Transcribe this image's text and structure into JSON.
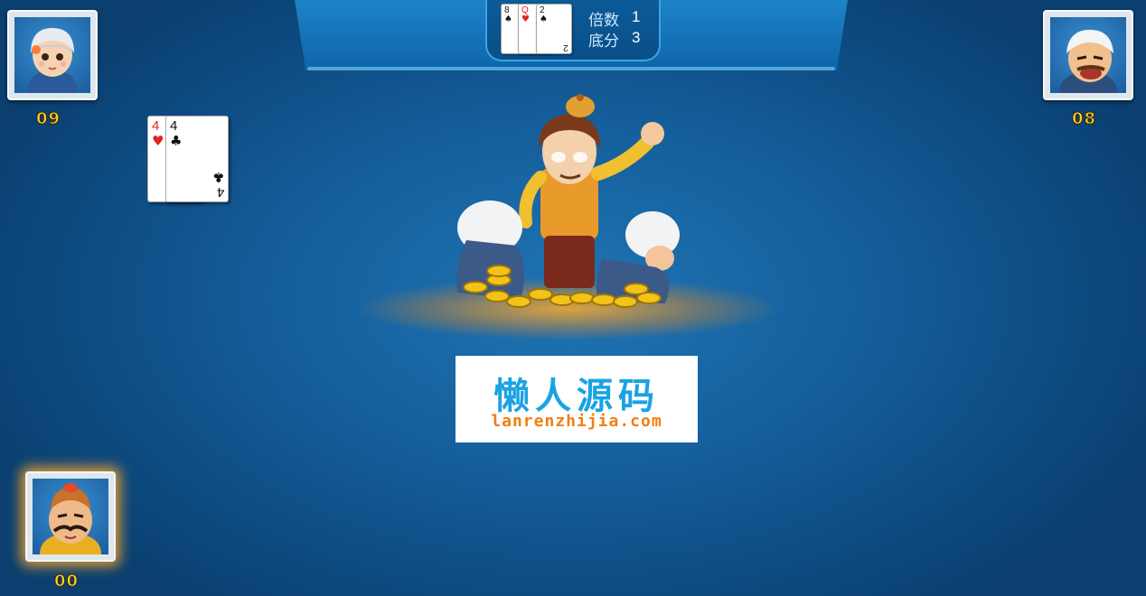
{
  "top_bar": {
    "bottom_cards": [
      {
        "rank": "8",
        "suit": "♠",
        "color": "#111111"
      },
      {
        "rank": "Q",
        "suit": "♥",
        "color": "#e52222"
      },
      {
        "rank": "2",
        "suit": "♠",
        "color": "#111111"
      }
    ],
    "multiplier_label": "倍数",
    "multiplier_value": "1",
    "base_score_label": "底分",
    "base_score_value": "3"
  },
  "players": {
    "left": {
      "avatar_icon": "girl-avatar-icon",
      "card_count": "09"
    },
    "right": {
      "avatar_icon": "bald-man-avatar-icon",
      "card_count": "08"
    },
    "self": {
      "avatar_icon": "mustache-man-avatar-icon",
      "card_count": "00"
    }
  },
  "played_cards": {
    "left_player": [
      {
        "rank": "4",
        "suit": "♥",
        "color": "#e52222"
      },
      {
        "rank": "4",
        "suit": "♣",
        "color": "#111111"
      }
    ]
  },
  "center_illustration": {
    "icon": "landlord-wins-icon"
  },
  "watermark": {
    "title": "懒人源码",
    "url": "lanrenzhijia.com"
  }
}
